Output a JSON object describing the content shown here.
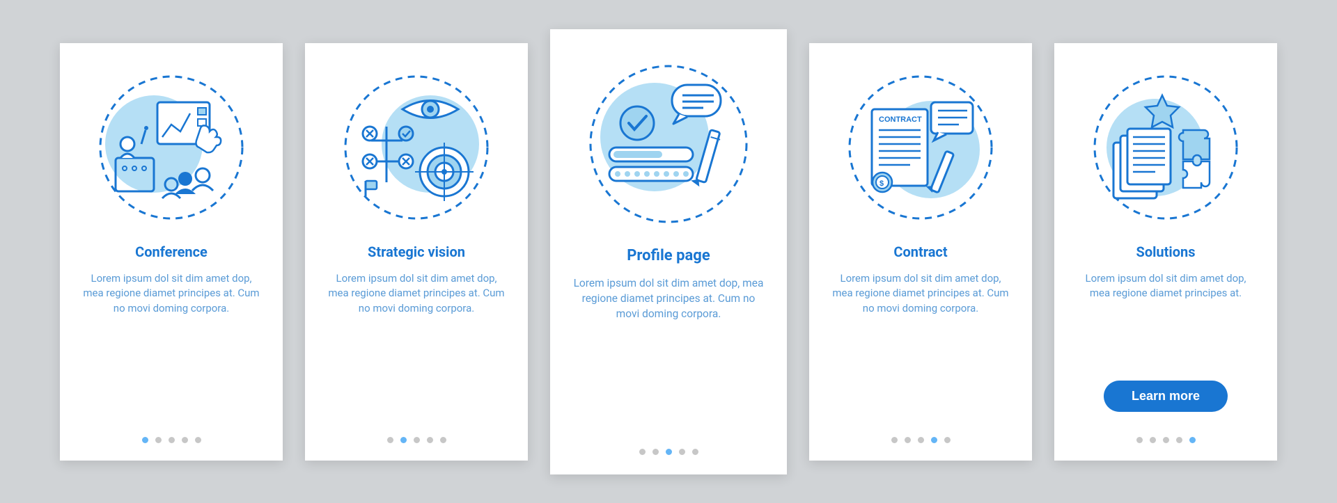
{
  "colors": {
    "primary": "#1976d2",
    "light_blue": "#64b5f6",
    "fill_blue": "#9fd4f0",
    "circle_fill": "#b5dff5",
    "text_body": "#5a9bd6",
    "dot_inactive": "#c7c7c7",
    "card_bg": "#ffffff",
    "page_bg": "#d0d3d6"
  },
  "cards": [
    {
      "title": "Conference",
      "icon": "conference-icon",
      "description": "Lorem ipsum dol sit dim amet dop, mea regione diamet principes at. Cum no movi doming corpora.",
      "active_index": 0,
      "dot_count": 5,
      "has_button": false
    },
    {
      "title": "Strategic vision",
      "icon": "strategic-vision-icon",
      "description": "Lorem ipsum dol sit dim amet dop, mea regione diamet principes at. Cum no movi doming corpora.",
      "active_index": 1,
      "dot_count": 5,
      "has_button": false
    },
    {
      "title": "Profile page",
      "icon": "profile-page-icon",
      "description": "Lorem ipsum dol sit dim amet dop, mea regione diamet principes at. Cum no movi doming corpora.",
      "active_index": 2,
      "dot_count": 5,
      "has_button": false,
      "featured": true
    },
    {
      "title": "Contract",
      "icon": "contract-icon",
      "description": "Lorem ipsum dol sit dim amet dop, mea regione diamet principes at. Cum no movi doming corpora.",
      "active_index": 3,
      "dot_count": 5,
      "has_button": false
    },
    {
      "title": "Solutions",
      "icon": "solutions-icon",
      "description": "Lorem ipsum dol sit dim amet dop, mea regione diamet principes at.",
      "active_index": 4,
      "dot_count": 5,
      "has_button": true,
      "button_label": "Learn more"
    }
  ]
}
